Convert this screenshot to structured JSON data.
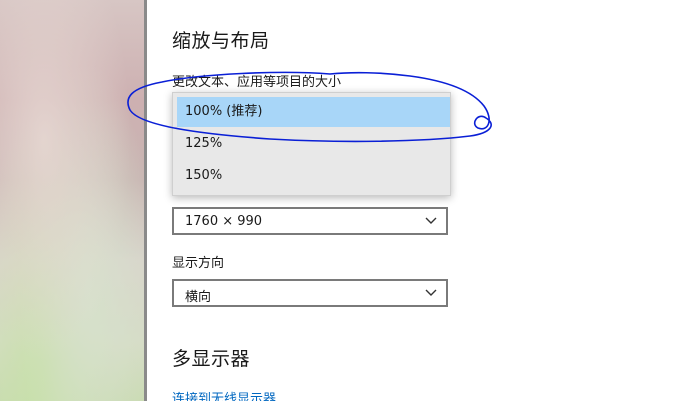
{
  "settings": {
    "scale_layout": {
      "title": "缩放与布局",
      "text_size_label": "更改文本、应用等项目的大小",
      "text_size_options": [
        {
          "label": "100% (推荐)",
          "selected": true
        },
        {
          "label": "125%",
          "selected": false
        },
        {
          "label": "150%",
          "selected": false
        }
      ],
      "resolution_value": "1760 × 990",
      "orientation_label": "显示方向",
      "orientation_value": "横向"
    },
    "multi_display": {
      "title": "多显示器",
      "wireless_link": "连接到无线显示器"
    }
  },
  "icons": {
    "dropdown_chevron": "chevron-down-icon"
  },
  "colors": {
    "selection_highlight": "#a8d6f8",
    "link": "#0067c0",
    "annotation_stroke": "#0a1fd6"
  }
}
